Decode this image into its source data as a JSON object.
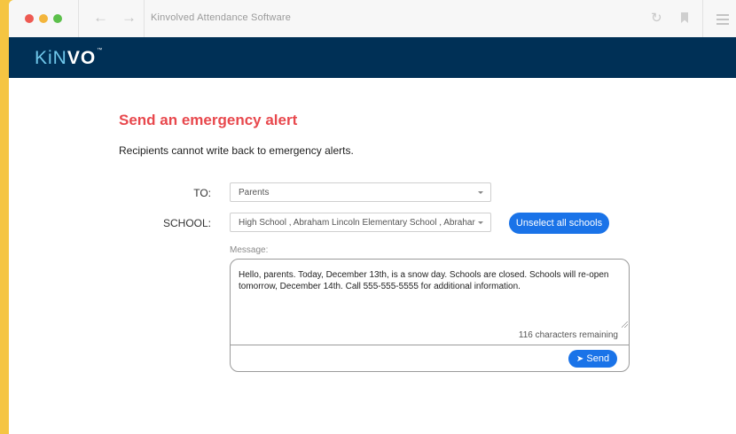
{
  "window": {
    "title": "Kinvolved Attendance Software"
  },
  "header": {
    "logo_light": "KiN",
    "logo_bold": "VO",
    "logo_tm": "™"
  },
  "page": {
    "title": "Send an emergency alert",
    "subtitle": "Recipients cannot write back to emergency alerts."
  },
  "form": {
    "to_label": "TO:",
    "to_value": "Parents",
    "school_label": "SCHOOL:",
    "school_value": "High School , Abraham Lincoln Elementary School , Abrahar",
    "unselect_button": "Unselect all schools",
    "message_label": "Message:",
    "message_text": "Hello, parents. Today, December 13th, is a snow day. Schools are closed. Schools will re-open tomorrow, December 14th. Call 555-555-5555 for additional information.",
    "chars_remaining": "116 characters remaining",
    "send_button": "Send"
  },
  "icons": {
    "back": "arrow-left-icon",
    "forward": "arrow-right-icon",
    "reload": "reload-icon",
    "bookmark": "bookmark-icon",
    "menu": "hamburger-menu-icon",
    "send": "paper-plane-icon"
  },
  "colors": {
    "header_bg": "#003056",
    "title_red": "#e8484d",
    "button_blue": "#1a73e8",
    "background_yellow": "#f5c542"
  }
}
